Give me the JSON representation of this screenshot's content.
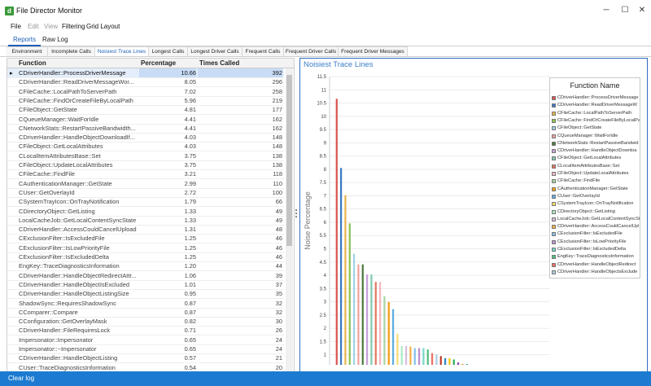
{
  "window": {
    "title": "File Director Monitor",
    "icon_label": "d",
    "min_glyph": "─",
    "max_glyph": "☐",
    "close_glyph": "✕"
  },
  "menu": [
    {
      "label": "File",
      "enabled": true
    },
    {
      "label": "Edit",
      "enabled": false
    },
    {
      "label": "View",
      "enabled": false
    },
    {
      "label": "Filtering",
      "enabled": true
    },
    {
      "label": "Grid Layout",
      "enabled": true
    }
  ],
  "top_tabs": [
    {
      "label": "Reports",
      "active": true
    },
    {
      "label": "Raw Log",
      "active": false
    }
  ],
  "sub_tabs": [
    {
      "label": "Environment",
      "active": false
    },
    {
      "label": "Incomplete Calls",
      "active": false
    },
    {
      "label": "Noisiest Trace Lines",
      "active": true
    },
    {
      "label": "Longest Calls",
      "active": false
    },
    {
      "label": "Longest Driver Calls",
      "active": false
    },
    {
      "label": "Frequent Calls",
      "active": false
    },
    {
      "label": "Frequent Driver Calls",
      "active": false
    },
    {
      "label": "Frequent Driver Messages",
      "active": false
    }
  ],
  "grid": {
    "columns": [
      "Function",
      "Percentage",
      "Times Called"
    ],
    "row_indicator": "▸",
    "rows": [
      [
        "CDriverHandler::ProcessDriverMessage",
        "10.66",
        "392"
      ],
      [
        "CDriverHandler::ReadDriverMessageWor...",
        "8.05",
        "296"
      ],
      [
        "CFileCache::LocalPathToServerPath",
        "7.02",
        "258"
      ],
      [
        "CFileCache::FindOrCreateFileByLocalPath",
        "5.96",
        "219"
      ],
      [
        "CFileObject::GetState",
        "4.81",
        "177"
      ],
      [
        "CQueueManager::WaitForIdle",
        "4.41",
        "162"
      ],
      [
        "CNetworkStats::RestartPassiveBandwidth...",
        "4.41",
        "162"
      ],
      [
        "CDriverHandler::HandleObjectDownloadIf...",
        "4.03",
        "148"
      ],
      [
        "CFileObject::GetLocalAttributes",
        "4.03",
        "148"
      ],
      [
        "CLocalItemAttributesBase::Set",
        "3.75",
        "138"
      ],
      [
        "CFileObject::UpdateLocalAttributes",
        "3.75",
        "138"
      ],
      [
        "CFileCache::FindFile",
        "3.21",
        "118"
      ],
      [
        "CAuthenticationManager::GetState",
        "2.99",
        "110"
      ],
      [
        "CUser::GetOverlayId",
        "2.72",
        "100"
      ],
      [
        "CSystemTrayIcon::OnTrayNotification",
        "1.79",
        "66"
      ],
      [
        "CDirectoryObject::GetListing",
        "1.33",
        "49"
      ],
      [
        "LocalCacheJob::GetLocalContentSyncState",
        "1.33",
        "49"
      ],
      [
        "CDriverHandler::AccessCouldCancelUpload",
        "1.31",
        "48"
      ],
      [
        "CExclusionFilter::IsExcludedFile",
        "1.25",
        "46"
      ],
      [
        "CExclusionFilter::IsLowPriorityFile",
        "1.25",
        "46"
      ],
      [
        "CExclusionFilter::IsExcludedDelta",
        "1.25",
        "46"
      ],
      [
        "EngKey::TraceDiagnosticsInformation",
        "1.20",
        "44"
      ],
      [
        "CDriverHandler::HandleObjectRedirectAttr...",
        "1.06",
        "39"
      ],
      [
        "CDriverHandler::HandleObjectIsExcluded",
        "1.01",
        "37"
      ],
      [
        "CDriverHandler::HandleObjectListingSize",
        "0.95",
        "35"
      ],
      [
        "ShadowSync::RequiresShadowSync",
        "0.87",
        "32"
      ],
      [
        "CComparer::Compare",
        "0.87",
        "32"
      ],
      [
        "CConfiguration::GetOverlayMask",
        "0.82",
        "30"
      ],
      [
        "CDriverHandler::FileRequiresLock",
        "0.71",
        "26"
      ],
      [
        "Impersonator::Impersonator",
        "0.65",
        "24"
      ],
      [
        "Impersonator::~Impersonator",
        "0.65",
        "24"
      ],
      [
        "CDriverHandler::HandleObjectListing",
        "0.57",
        "21"
      ],
      [
        "CUser::TraceDiagnosticsInformation",
        "0.54",
        "20"
      ]
    ]
  },
  "chart_title": "Noisiest Trace Lines",
  "legend_title": "Function Name",
  "legend_items": [
    {
      "label": "CDriverHandler::ProcessDriverMessage",
      "color": "#d9534f"
    },
    {
      "label": "CDriverHandler::ReadDriverMessageW",
      "color": "#3b78c4"
    },
    {
      "label": "CFileCache::LocalPathToServerPath",
      "color": "#e8b44a"
    },
    {
      "label": "CFileCache::FindOrCreateFileByLocalPat",
      "color": "#8bc34a"
    },
    {
      "label": "CFileObject::GetState",
      "color": "#9fd3e6"
    },
    {
      "label": "CQueueManager::WaitForIdle",
      "color": "#f0a0a0"
    },
    {
      "label": "CNetworkStats::RestartPassiveBandwid",
      "color": "#4a7a3a"
    },
    {
      "label": "CDriverHandler::HandleObjectDownloa",
      "color": "#c8a0d8"
    },
    {
      "label": "CFileObject::GetLocalAttributes",
      "color": "#7fc9b0"
    },
    {
      "label": "CLocalItemAttributesBase::Set",
      "color": "#e07a5f"
    },
    {
      "label": "CFileObject::UpdateLocalAttributes",
      "color": "#f4b6c2"
    },
    {
      "label": "CFileCache::FindFile",
      "color": "#a8d5a2"
    },
    {
      "label": "CAuthenticationManager::GetState",
      "color": "#f39c12"
    },
    {
      "label": "CUser::GetOverlayId",
      "color": "#5dade2"
    },
    {
      "label": "CSystemTrayIcon::OnTrayNotification",
      "color": "#f7dc6f"
    },
    {
      "label": "CDirectoryObject::GetListing",
      "color": "#abebc6"
    },
    {
      "label": "LocalCacheJob::GetLocalContentSyncSt",
      "color": "#d7bde2"
    },
    {
      "label": "CDriverHandler::AccessCouldCancelUpl",
      "color": "#f5b041"
    },
    {
      "label": "CExclusionFilter::IsExcludedFile",
      "color": "#85c1e9"
    },
    {
      "label": "CExclusionFilter::IsLowPriorityFile",
      "color": "#bb8fce"
    },
    {
      "label": "CExclusionFilter::IsExcludedDelta",
      "color": "#76d7c4"
    },
    {
      "label": "EngKey::TraceDiagnosticsInformation",
      "color": "#52be80"
    },
    {
      "label": "CDriverHandler::HandleObjectRedirect",
      "color": "#ec7063"
    },
    {
      "label": "CDriverHandler::HandleObjectsExclude",
      "color": "#a9cce3"
    }
  ],
  "chart_data": {
    "type": "bar",
    "title": "Noisiest Trace Lines",
    "xlabel": "",
    "ylabel": "Noise Percentage",
    "ylim": [
      0,
      11.5
    ],
    "yticks": [
      "1",
      "1.5",
      "2",
      "2.5",
      "3",
      "3.5",
      "4",
      "4.5",
      "5",
      "5.5",
      "6",
      "6.5",
      "7",
      "7.5",
      "8",
      "8.5",
      "9",
      "9.5",
      "10",
      "10.5",
      "11",
      "11.5"
    ],
    "grid": true,
    "legend_position": "right",
    "values": [
      10.66,
      8.05,
      7.02,
      5.96,
      4.81,
      4.41,
      4.41,
      4.03,
      4.03,
      3.75,
      3.75,
      3.21,
      2.99,
      2.72,
      1.79,
      1.33,
      1.33,
      1.31,
      1.25,
      1.25,
      1.25,
      1.2,
      1.06,
      1.01,
      0.95,
      0.87,
      0.87,
      0.82,
      0.71,
      0.65,
      0.65,
      0.57,
      0.54,
      0.5,
      0.46,
      0.43,
      0.41,
      0.38,
      0.35,
      0.33,
      0.3,
      0.27,
      0.25,
      0.22,
      0.2,
      0.18,
      0.15,
      0.12
    ]
  },
  "status": {
    "clear_log": "Clear log"
  }
}
